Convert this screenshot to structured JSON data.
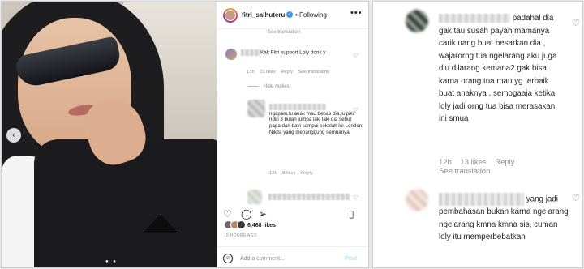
{
  "post": {
    "username": "fitri_salhuteru",
    "follow_label": "Following",
    "top_see_translation": "See translation",
    "likes": "6,468 likes",
    "posted_ago": "15 HOURS AGO",
    "add_comment_placeholder": "Add a comment...",
    "post_label": "Post"
  },
  "comments": [
    {
      "text": "Kak Fitri support Loly donk y",
      "time": "13h",
      "likes": "31 likes",
      "reply": "Reply",
      "translate": "See translation"
    },
    {
      "hide_replies": "Hide replies",
      "text": "ngapain,tu anak mau bebas dia,lu pikir ndiri 3 bulan jumpa laki laki dia sebut papa,dari bayi sampai sekolah ke London Nikita yang menanggung semuanya",
      "time": "12h",
      "likes": "8 likes",
      "reply": "Reply"
    }
  ],
  "zoom_comments": [
    {
      "text": "padahal dia gak tau susah payah mamanya carik uang buat besarkan dia , wajarorng tua ngelarang aku juga dlu dilarang kemana2 gak bisa karna orang tua mau yg terbaik buat anaknya , semogaaja ketika loly jadi orng tua bisa merasakan ini smua",
      "time": "12h",
      "likes": "13 likes",
      "reply": "Reply",
      "translate": "See translation"
    },
    {
      "text": "yang jadi pembahasan bukan karna ngelarang ngelarang kmna kmna sis, cuman loly itu memperbebatkan"
    }
  ],
  "icons": [
    "verified-icon",
    "more-options-icon",
    "heart-icon",
    "comment-icon",
    "share-icon",
    "bookmark-icon",
    "emoji-icon",
    "carousel-arrow-icon"
  ]
}
